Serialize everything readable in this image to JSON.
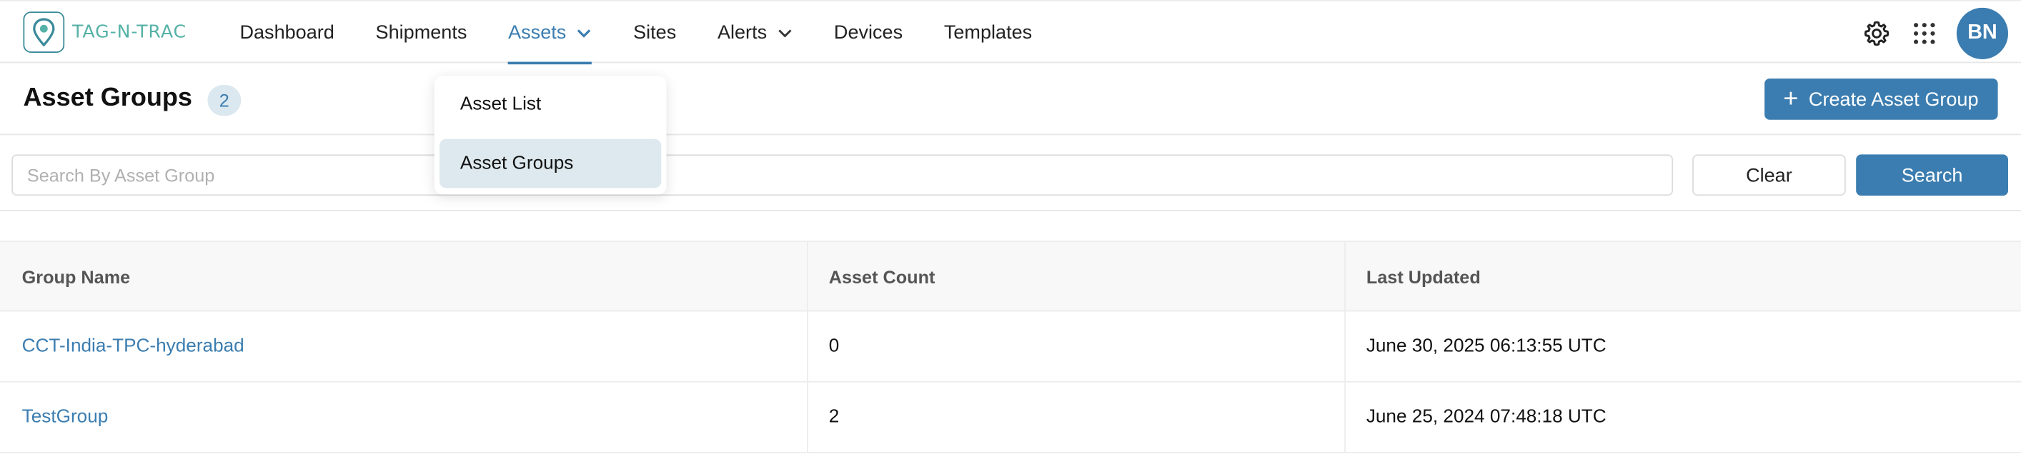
{
  "brand": {
    "logo_text": "TAG-N-TRAC"
  },
  "nav": {
    "items": [
      {
        "label": "Dashboard"
      },
      {
        "label": "Shipments"
      },
      {
        "label": "Assets"
      },
      {
        "label": "Sites"
      },
      {
        "label": "Alerts"
      },
      {
        "label": "Devices"
      },
      {
        "label": "Templates"
      }
    ],
    "active": "Assets"
  },
  "topbar": {
    "settings_icon": "gear-icon",
    "apps_icon": "grid-icon",
    "avatar_initials": "BN"
  },
  "assets_menu": {
    "items": [
      {
        "label": "Asset List"
      },
      {
        "label": "Asset Groups",
        "selected": true
      }
    ]
  },
  "header": {
    "title": "Asset Groups",
    "count": "2",
    "create_label": "Create Asset Group"
  },
  "search": {
    "placeholder": "Search By Asset Group",
    "value": "",
    "clear_label": "Clear",
    "search_label": "Search"
  },
  "table": {
    "columns": [
      "Group Name",
      "Asset Count",
      "Last Updated"
    ],
    "rows": [
      {
        "group_name": "CCT-India-TPC-hyderabad",
        "asset_count": "0",
        "last_updated": "June 30, 2025 06:13:55 UTC"
      },
      {
        "group_name": "TestGroup",
        "asset_count": "2",
        "last_updated": "June 25, 2024 07:48:18 UTC"
      }
    ]
  },
  "colors": {
    "accent": "#3b7db0",
    "logo": "#56b2a7",
    "badge_bg": "#dbe8ef",
    "selected_bg": "#dde9ee"
  }
}
